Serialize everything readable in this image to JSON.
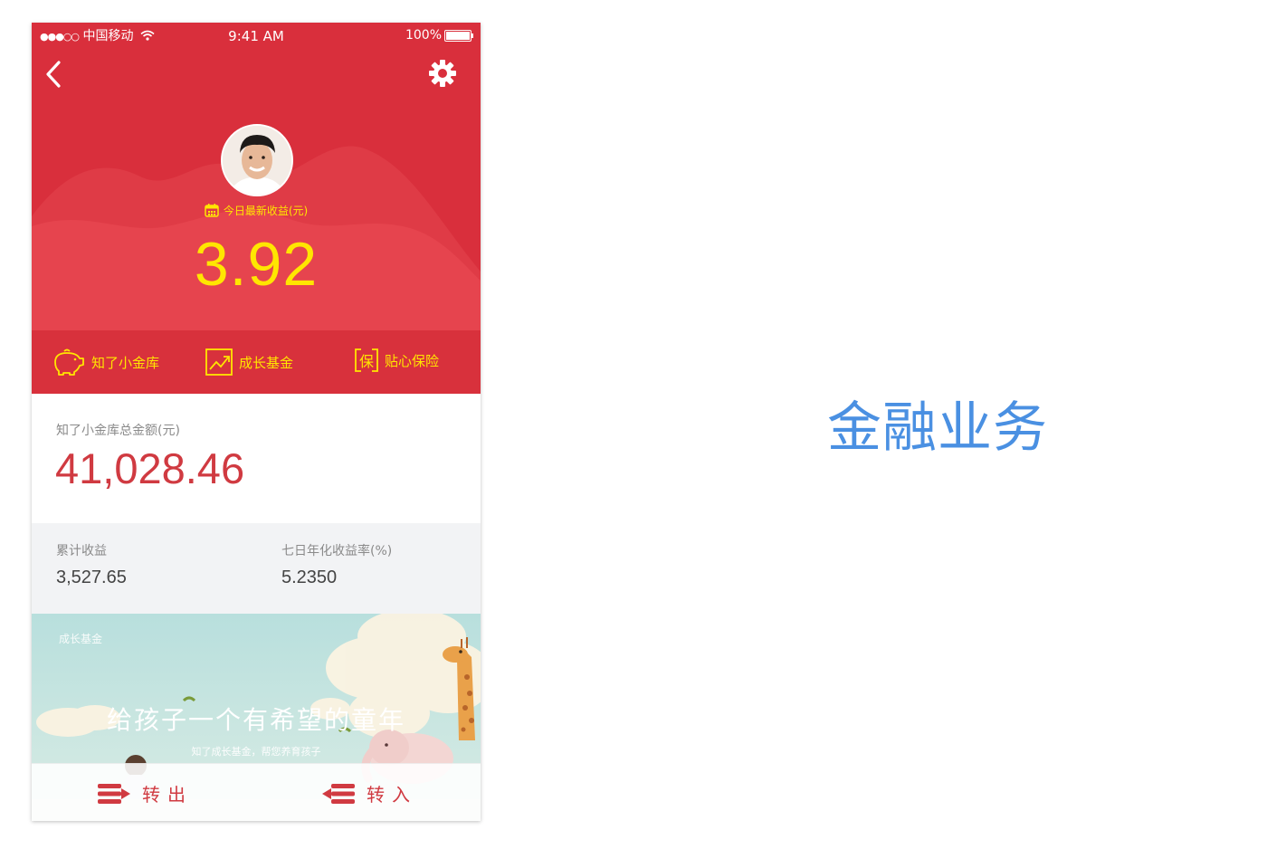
{
  "status_bar": {
    "signal": "●●●○○",
    "carrier": "中国移动",
    "time": "9:41 AM",
    "battery": "100%"
  },
  "header": {
    "back_icon": "chevron-left-icon",
    "settings_icon": "gear-icon",
    "today_label": "今日最新收益(元)",
    "today_value": "3.92"
  },
  "shortcuts": [
    {
      "label": "知了小金库",
      "icon": "piggy-bank-icon"
    },
    {
      "label": "成长基金",
      "icon": "trend-chart-icon"
    },
    {
      "label": "贴心保险",
      "icon": "insurance-icon",
      "icon_char": "保"
    }
  ],
  "total": {
    "label": "知了小金库总金额(元)",
    "value": "41,028.46"
  },
  "stats": [
    {
      "label": "累计收益",
      "value": "3,527.65"
    },
    {
      "label": "七日年化收益率(%)",
      "value": "5.2350"
    }
  ],
  "banner": {
    "tag": "成长基金",
    "slogan": "给孩子一个有希望的童年",
    "sub": "知了成长基金，帮您养育孩子"
  },
  "bottom_bar": {
    "transfer_out": "转出",
    "transfer_in": "转入"
  },
  "page_title": "金融业务",
  "colors": {
    "brand_red": "#d92f3c",
    "highlight_yellow": "#ffe600",
    "amount_red": "#d03a41",
    "title_blue": "#4a90e2"
  }
}
